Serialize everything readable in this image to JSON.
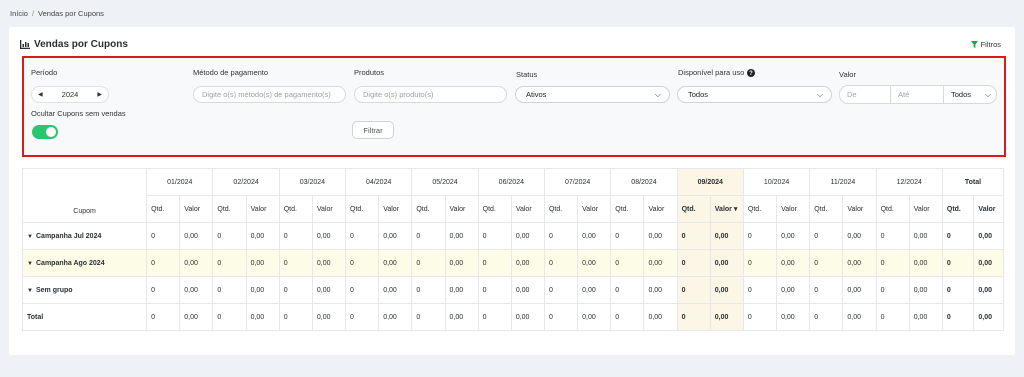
{
  "breadcrumb": {
    "home": "Início",
    "separator": "/",
    "current": "Vendas por Cupons"
  },
  "page": {
    "title": "Vendas por Cupons",
    "filters_link": "Filtros"
  },
  "filters": {
    "period_label": "Período",
    "year": "2024",
    "payment_label": "Método de pagamento",
    "payment_placeholder": "Digite o(s) método(s) de pagamento(s)",
    "products_label": "Produtos",
    "products_placeholder": "Digite o(s) produto(s)",
    "status_label": "Status",
    "status_value": "Ativos",
    "available_label": "Disponível para uso",
    "available_value": "Todos",
    "value_label": "Valor",
    "value_from_placeholder": "De",
    "value_to_placeholder": "Até",
    "value_mode": "Todos",
    "hide_label": "Ocultar Cupons sem vendas",
    "hide_toggle_on": true,
    "filter_button": "Filtrar"
  },
  "table": {
    "first_col_header": "Cupom",
    "months": [
      "01/2024",
      "02/2024",
      "03/2024",
      "04/2024",
      "05/2024",
      "06/2024",
      "07/2024",
      "08/2024",
      "09/2024",
      "10/2024",
      "11/2024",
      "12/2024"
    ],
    "total_header": "Total",
    "qty_header": "Qtd.",
    "value_header": "Valor",
    "sorted_value_header": "Valor ▾",
    "rows": [
      {
        "label": "Campanha Jul 2024",
        "qty": "0",
        "value": "0,00"
      },
      {
        "label": "Campanha Ago 2024",
        "qty": "0",
        "value": "0,00"
      },
      {
        "label": "Sem grupo",
        "qty": "0",
        "value": "0,00"
      },
      {
        "label": "Total",
        "qty": "0",
        "value": "0,00"
      }
    ]
  },
  "colors": {
    "accent_green": "#28c76f",
    "highlight_border": "#e01818",
    "row_highlight": "#fdfde7"
  }
}
